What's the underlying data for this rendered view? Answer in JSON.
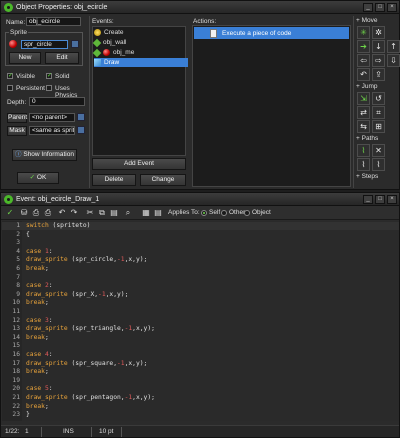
{
  "object_window": {
    "title": "Object Properties: obj_ecircle",
    "name_label": "Name:",
    "name_value": "obj_ecircle",
    "sprite_group": "Sprite",
    "sprite_value": "spr_circle",
    "new_button": "New",
    "edit_button": "Edit",
    "visible_label": "Visible",
    "solid_label": "Solid",
    "persistent_label": "Persistent",
    "physics_label": "Uses Physics",
    "depth_label": "Depth:",
    "depth_value": "0",
    "parent_label": "Parent",
    "parent_value": "<no parent>",
    "mask_label": "Mask",
    "mask_value": "<same as sprite>",
    "show_info_button": "Show Information",
    "ok_button": "OK",
    "events_label": "Events:",
    "events": [
      {
        "label": "Create",
        "icon": "bulb-icon",
        "selected": false
      },
      {
        "label": "obj_wall",
        "icon": "collision-icon",
        "selected": false
      },
      {
        "label": "obj_me",
        "icon": "collision-icon",
        "selected": false
      },
      {
        "label": "Draw",
        "icon": "draw-icon",
        "selected": true
      }
    ],
    "add_event_button": "Add Event",
    "delete_button": "Delete",
    "change_button": "Change",
    "actions_label": "Actions:",
    "actions": [
      {
        "label": "Execute a piece of code",
        "icon": "code-icon"
      }
    ],
    "palette_sections": [
      "Move",
      "Jump",
      "Paths",
      "Steps"
    ]
  },
  "code_window": {
    "title": "Event: obj_ecircle_Draw_1",
    "applies_to_label": "Applies To:",
    "self_label": "Self",
    "other_label": "Other",
    "object_label": "Object",
    "applies_to_selected": "Self",
    "code_lines": [
      {
        "n": "1",
        "text": "switch (spriteto)"
      },
      {
        "n": "2",
        "text": "{"
      },
      {
        "n": "3",
        "text": ""
      },
      {
        "n": "4",
        "text": "case 1:"
      },
      {
        "n": "5",
        "text": "draw_sprite (spr_circle,-1,x,y);"
      },
      {
        "n": "6",
        "text": "break;"
      },
      {
        "n": "7",
        "text": ""
      },
      {
        "n": "8",
        "text": "case 2:"
      },
      {
        "n": "9",
        "text": "draw_sprite (spr_X,-1,x,y);"
      },
      {
        "n": "10",
        "text": "break;"
      },
      {
        "n": "11",
        "text": ""
      },
      {
        "n": "12",
        "text": "case 3:"
      },
      {
        "n": "13",
        "text": "draw_sprite (spr_triangle,-1,x,y);"
      },
      {
        "n": "14",
        "text": "break;"
      },
      {
        "n": "15",
        "text": ""
      },
      {
        "n": "16",
        "text": "case 4:"
      },
      {
        "n": "17",
        "text": "draw_sprite (spr_square,-1,x,y);"
      },
      {
        "n": "18",
        "text": "break;"
      },
      {
        "n": "19",
        "text": ""
      },
      {
        "n": "20",
        "text": "case 5:"
      },
      {
        "n": "21",
        "text": "draw_sprite (spr_pentagon,-1,x,y);"
      },
      {
        "n": "22",
        "text": "break;"
      },
      {
        "n": "23",
        "text": "}"
      }
    ],
    "status": {
      "position": "1/22:",
      "column": "1",
      "mode": "INS",
      "font_size": "10 pt"
    }
  },
  "colors": {
    "selection": "#3a7fd6",
    "keyword": "#e8a33b",
    "number": "#e05a5a",
    "accent_green": "#6fd64a"
  }
}
